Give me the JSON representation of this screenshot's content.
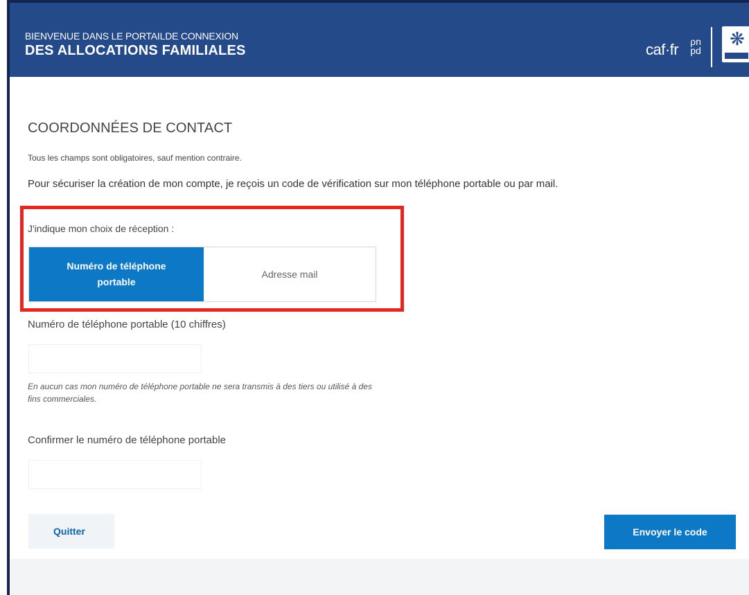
{
  "header": {
    "welcome": "BIENVENUE DANS LE PORTAILDE CONNEXION",
    "title": "DES ALLOCATIONS FAMILIALES",
    "logo_text": "caf·fr",
    "mark_top": "ρn",
    "mark_bottom": "pd"
  },
  "form": {
    "section_title": "COORDONNÉES DE CONTACT",
    "mandatory_note": "Tous les champs sont obligatoires, sauf mention contraire.",
    "intro": "Pour sécuriser la création de mon compte, je reçois un code de vérification sur mon téléphone portable ou par mail.",
    "choice_label": "J'indique mon choix de réception :",
    "options": [
      {
        "label": "Numéro de téléphone portable",
        "selected": true
      },
      {
        "label": "Adresse mail",
        "selected": false
      }
    ],
    "phone_label": "Numéro de téléphone portable (10 chiffres)",
    "phone_value": "",
    "privacy_note": "En aucun cas mon numéro de téléphone portable ne sera transmis à des tiers ou utilisé à des fins commerciales.",
    "confirm_label": "Confirmer le numéro de téléphone portable",
    "confirm_value": ""
  },
  "actions": {
    "quit": "Quitter",
    "send": "Envoyer le code"
  },
  "colors": {
    "header_bg": "#254a8a",
    "accent": "#0d79c6",
    "highlight": "#e52621"
  },
  "icons": {
    "emblem": "republic-emblem-icon"
  }
}
